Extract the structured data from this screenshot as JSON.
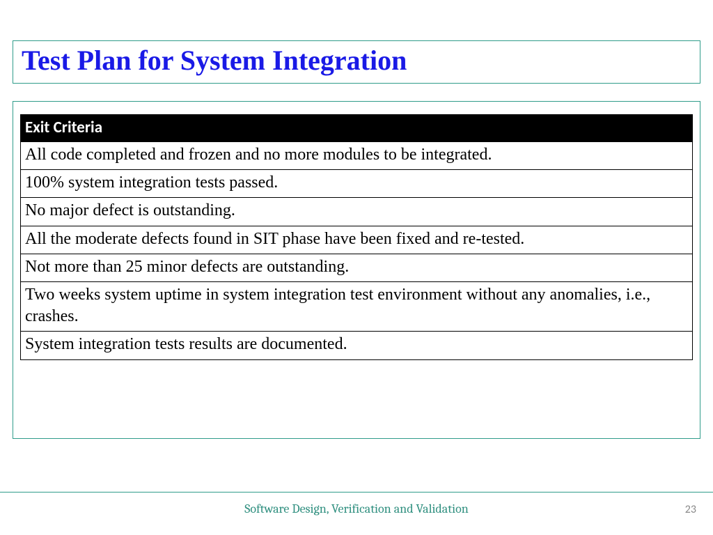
{
  "title": "Test Plan for System Integration",
  "table": {
    "header": "Exit Criteria",
    "rows": [
      "All code completed and frozen and no more modules to be integrated.",
      "100% system integration tests passed.",
      "No major defect is outstanding.",
      "All the moderate defects found in SIT phase have been fixed and re-tested.",
      "Not more than 25 minor defects are outstanding.",
      "Two weeks system uptime in system integration test environment without any anomalies, i.e., crashes.",
      "System integration tests results are documented."
    ]
  },
  "footer": "Software Design, Verification and Validation",
  "page_number": "23"
}
